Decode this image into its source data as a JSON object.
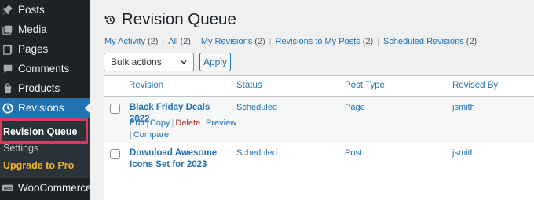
{
  "sidebar": {
    "items": [
      {
        "label": "Posts",
        "icon": "pin-icon"
      },
      {
        "label": "Media",
        "icon": "media-icon"
      },
      {
        "label": "Pages",
        "icon": "pages-icon"
      },
      {
        "label": "Comments",
        "icon": "comments-icon"
      },
      {
        "label": "Products",
        "icon": "products-icon"
      },
      {
        "label": "Revisions",
        "icon": "revisions-icon"
      }
    ],
    "submenu": {
      "current": "Revision Queue",
      "settings": "Settings",
      "upgrade": "Upgrade to Pro"
    },
    "woocommerce": {
      "label": "WooCommerce",
      "icon": "woo-icon"
    }
  },
  "page": {
    "title": "Revision Queue",
    "title_icon": "history-icon"
  },
  "filters": [
    {
      "label": "My Activity",
      "count": "(2)"
    },
    {
      "label": "All",
      "count": "(2)"
    },
    {
      "label": "My Revisions",
      "count": "(2)"
    },
    {
      "label": "Revisions to My Posts",
      "count": "(2)"
    },
    {
      "label": "Scheduled Revisions",
      "count": "(2)"
    }
  ],
  "bulk_actions": {
    "selected": "Bulk actions",
    "apply_label": "Apply"
  },
  "table": {
    "columns": [
      "Revision",
      "Status",
      "Post Type",
      "Revised By"
    ],
    "rows": [
      {
        "revision": "Black Friday Deals 2022",
        "status": "Scheduled",
        "post_type": "Page",
        "revised_by": "jsmith",
        "actions": {
          "edit": "Edit",
          "copy": "Copy",
          "delete": "Delete",
          "preview": "Preview",
          "compare": "Compare"
        }
      },
      {
        "revision_line1": "Download Awesome",
        "revision_line2": "Icons Set for 2023",
        "status": "Scheduled",
        "post_type": "Post",
        "revised_by": "jsmith"
      }
    ]
  },
  "colors": {
    "sidebar_bg": "#1d2327",
    "accent": "#2271b1",
    "highlight": "#d63c5b",
    "upgrade": "#f0b429",
    "delete": "#b32d2e"
  }
}
